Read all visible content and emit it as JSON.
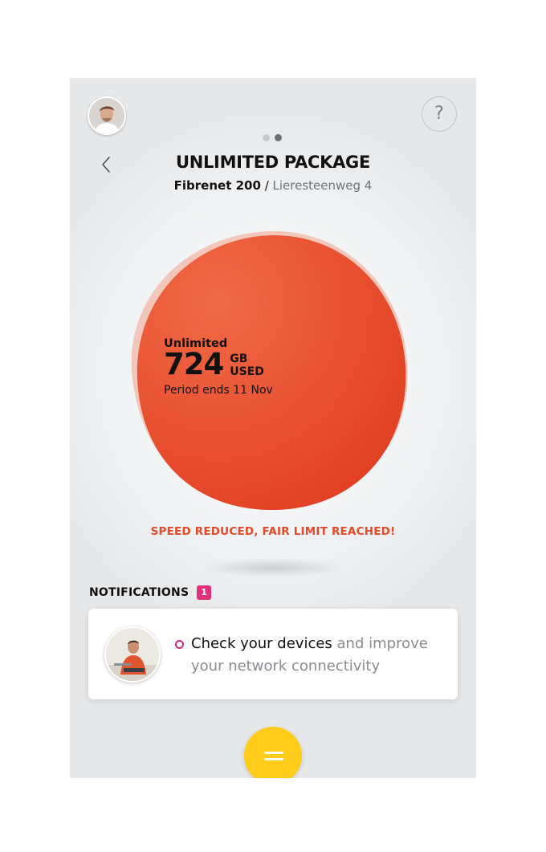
{
  "header": {
    "page_indicator": {
      "count": 2,
      "active_index": 1
    },
    "help_label": "?",
    "title": "UNLIMITED PACKAGE",
    "plan_name": "Fibrenet 200",
    "separator": " / ",
    "address": "Lieresteenweg 4"
  },
  "usage": {
    "label": "Unlimited",
    "amount": "724",
    "unit_line1": "GB",
    "unit_line2": "USED",
    "period": "Period ends 11 Nov",
    "color": "#e8492c"
  },
  "warning": "SPEED REDUCED, FAIR LIMIT REACHED!",
  "notifications": {
    "heading": "NOTIFICATIONS",
    "count": "1",
    "items": [
      {
        "title": "Check your devices",
        "body": " and improve your network connectivity"
      }
    ]
  },
  "fab": {
    "icon": "menu-icon",
    "color": "#ffcc1a"
  }
}
